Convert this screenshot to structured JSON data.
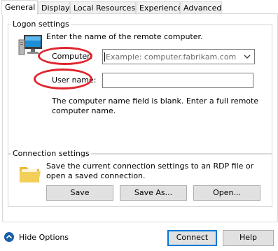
{
  "tabs": [
    {
      "label": "General"
    },
    {
      "label": "Display"
    },
    {
      "label": "Local Resources"
    },
    {
      "label": "Experience"
    },
    {
      "label": "Advanced"
    }
  ],
  "logon": {
    "title": "Logon settings",
    "instruction": "Enter the name of the remote computer.",
    "computer_label": "Computer:",
    "computer_placeholder": "Example: computer.fabrikam.com",
    "username_label": "User name:",
    "username_value": "",
    "warning": "The computer name field is blank. Enter a full remote computer name."
  },
  "connection": {
    "title": "Connection settings",
    "description": "Save the current connection settings to an RDP file or open a saved connection.",
    "save_label": "Save",
    "save_as_label": "Save As...",
    "open_label": "Open..."
  },
  "footer": {
    "hide_options_label": "Hide Options",
    "connect_label": "Connect",
    "help_label": "Help"
  },
  "colors": {
    "annotation": "#e0242c",
    "default_button_border": "#0078d7",
    "monitor_screen": "#1e8fd6",
    "folder": "#f3cf5a"
  },
  "icons": [
    "computer-icon",
    "folder-icon",
    "chevron-down-icon",
    "chevron-up-circle-icon"
  ]
}
